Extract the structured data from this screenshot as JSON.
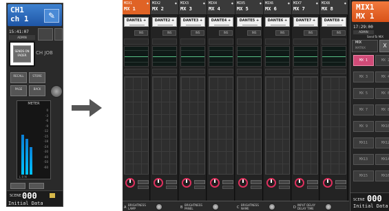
{
  "left_panel": {
    "channel_line1": "CH1",
    "channel_line2": "ch 1",
    "time": "15:41:07",
    "user": "ADMIN",
    "highlighted_button": "SENDS ON FADER",
    "ch_job_label": "CH JOB",
    "buttons": [
      "RECALL",
      "STORE",
      "PAGE",
      "BACK"
    ],
    "meter_label": "METER",
    "meter_scale": [
      "0",
      "-3",
      "-6",
      "-9",
      "-12",
      "-15",
      "-18",
      "-24",
      "-30",
      "-40",
      "-50",
      "-60"
    ],
    "meter_footer": "L  R  M",
    "scene_label": "SCENE",
    "scene_number": "000",
    "scene_name": "Initial Data"
  },
  "arrow_icon": "right-arrow-icon",
  "main": {
    "channels": [
      {
        "top": "MIX1",
        "name": "MX 1",
        "dante": "DANTE1 +"
      },
      {
        "top": "MIX2",
        "name": "MX 2",
        "dante": "DANTE2 +"
      },
      {
        "top": "MIX3",
        "name": "MX 3",
        "dante": "DANTE3 +"
      },
      {
        "top": "MIX4",
        "name": "MX 4",
        "dante": "DANTE4 +"
      },
      {
        "top": "MIX5",
        "name": "MX 5",
        "dante": "DANTE5 +"
      },
      {
        "top": "MIX6",
        "name": "MX 6",
        "dante": "DANTE6 +"
      },
      {
        "top": "MIX7",
        "name": "MX 7",
        "dante": "DANTE7 +"
      },
      {
        "top": "MIX8",
        "name": "MX 8",
        "dante": "DANTE8 +"
      }
    ],
    "selected_channel_index": 0,
    "selected_color": "#e06325",
    "ins_label": "INS",
    "knob_color": "#e0305e",
    "bottom_sections": [
      {
        "letter": "A",
        "line1": "BRIGHTNESS",
        "line2": "LAMP"
      },
      {
        "letter": "B",
        "line1": "BRIGHTNESS",
        "line2": "PANEL"
      },
      {
        "letter": "C",
        "line1": "BRIGHTNESS",
        "line2": "NAME"
      },
      {
        "letter": "D",
        "line1": "INPUT DELAY",
        "line2": "DELAY TIME"
      }
    ]
  },
  "right_panel": {
    "header_line1": "MIX1",
    "header_line2": "MX 1",
    "header_color": "#e06325",
    "time": "17:29:00",
    "user": "ADMIN",
    "send_to": "Send-To MIX",
    "mode_label": "MIX",
    "mode_sub": "MATRIX",
    "close_label": "X",
    "mix_buttons": [
      "MX 1",
      "MX 2",
      "MX 3",
      "MX 4",
      "MX 5",
      "MX 6",
      "MX 7",
      "MX 8",
      "MX 9",
      "MX10",
      "MX11",
      "MX12",
      "MX13",
      "MX14",
      "MX15",
      "MX16"
    ],
    "active_mix": "MX 1",
    "active_color": "#d14b78",
    "scene_label": "SCENE",
    "scene_number": "000",
    "scene_name": "Initial Data"
  }
}
